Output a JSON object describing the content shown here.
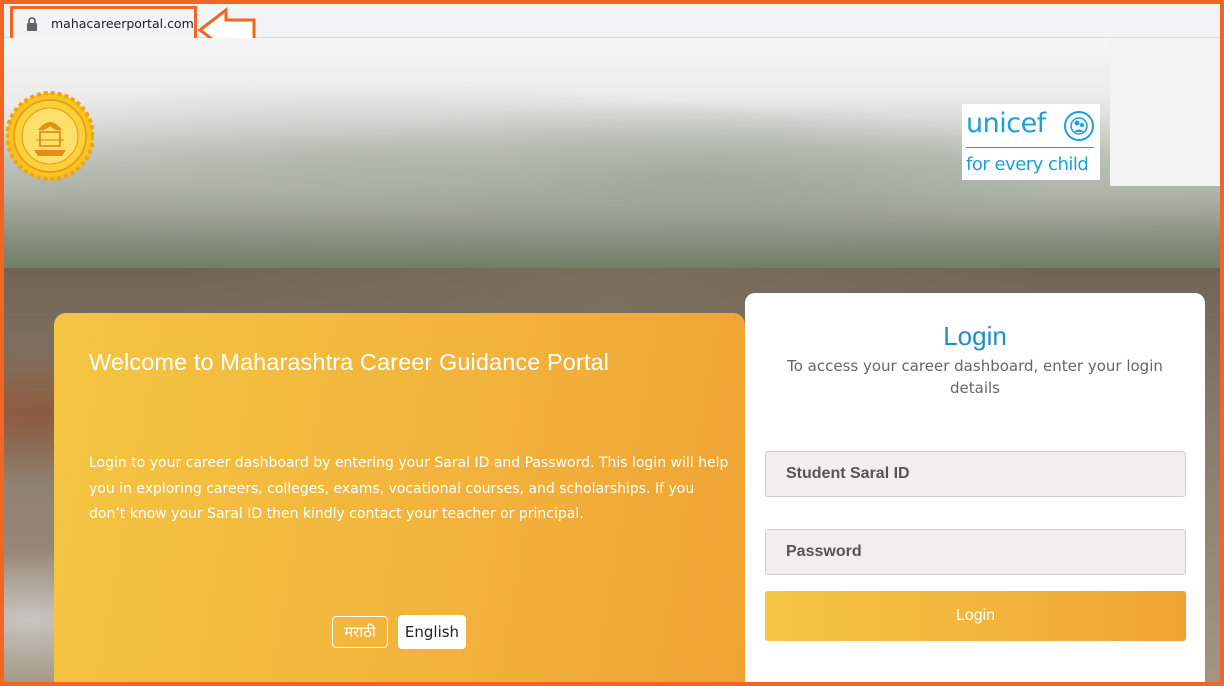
{
  "browser": {
    "url": "mahacareerportal.com"
  },
  "header": {
    "unicef_wordmark": "unicef",
    "unicef_tagline": "for every child"
  },
  "welcome": {
    "title": "Welcome to Maharashtra Career Guidance Portal",
    "text": "Login to your career dashboard by entering your Saral ID and Password. This login will help you in exploring careers, colleges, exams, vocational courses, and scholarships. If you don’t know your Saral ID then kindly contact your teacher or principal.",
    "languages": {
      "marathi": "मराठी",
      "english": "English"
    }
  },
  "login": {
    "title": "Login",
    "subtitle": "To access your career dashboard, enter your login details",
    "student_id_placeholder": "Student Saral ID",
    "password_placeholder": "Password",
    "button_label": "Login"
  },
  "colors": {
    "frame": "#f26522",
    "accent_blue": "#1d8fcf",
    "gradient_start": "#f4c542",
    "gradient_end": "#efa334"
  }
}
